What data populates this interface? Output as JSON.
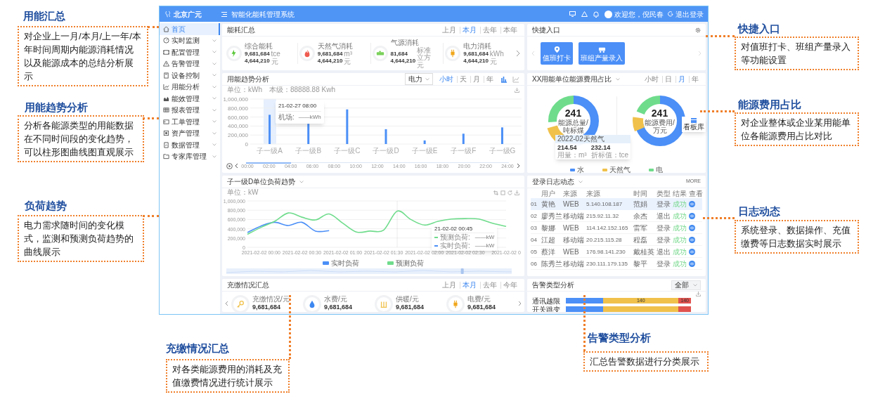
{
  "annotations": [
    {
      "title": "用能汇总",
      "text": "对企业上一月/本月/上一年/本年时间周期内能源消耗情况以及能源成本的总结分析展示"
    },
    {
      "title": "用能趋势分析",
      "text": "分析各能源类型的用能数据在不同时间段的变化趋势，可以柱形图曲线图直观展示"
    },
    {
      "title": "负荷趋势",
      "text": "电力需求随时间的变化模式，监测和预测负荷趋势的曲线展示"
    },
    {
      "title": "充缴情况汇总",
      "text": "对各类能源费用的消耗及充值缴费情况进行统计展示"
    },
    {
      "title": "快捷入口",
      "text": "对值班打卡、班组产量录入等功能设置"
    },
    {
      "title": "能源费用占比",
      "text": "对企业整体或企业某用能单位各能源费用占比对比"
    },
    {
      "title": "日志动态",
      "text": "系统登录、数据操作、充值缴费等日志数据实时展示"
    },
    {
      "title": "告警类型分析",
      "text": "汇总告警数据进行分类展示"
    }
  ],
  "header": {
    "logo": "北京广元",
    "title": "智能化能耗管理系统",
    "user": "欢迎您，倪民春",
    "logout": "退出登录"
  },
  "sidebar": {
    "items": [
      {
        "label": "首页",
        "selected": true,
        "expandable": false
      },
      {
        "label": "实时监测",
        "selected": false,
        "expandable": true
      },
      {
        "label": "配置管理",
        "selected": false,
        "expandable": true
      },
      {
        "label": "告警管理",
        "selected": false,
        "expandable": true
      },
      {
        "label": "设备控制",
        "selected": false,
        "expandable": true
      },
      {
        "label": "用能分析",
        "selected": false,
        "expandable": true
      },
      {
        "label": "能效管理",
        "selected": false,
        "expandable": true
      },
      {
        "label": "报表管理",
        "selected": false,
        "expandable": true
      },
      {
        "label": "工单管理",
        "selected": false,
        "expandable": true
      },
      {
        "label": "资产管理",
        "selected": false,
        "expandable": true
      },
      {
        "label": "数据管理",
        "selected": false,
        "expandable": true
      },
      {
        "label": "专家库管理",
        "selected": false,
        "expandable": true
      }
    ]
  },
  "energy_summary": {
    "title": "能耗汇总",
    "periods": [
      {
        "label": "上月",
        "selected": false
      },
      {
        "label": "本月",
        "selected": true
      },
      {
        "label": "去年",
        "selected": false
      },
      {
        "label": "本年",
        "selected": false
      }
    ],
    "items": [
      {
        "kind": "bolt",
        "label": "综合能耗",
        "value": "9,681,684",
        "unit": "tce",
        "cost": "4,644,210",
        "cost_unit": "元"
      },
      {
        "kind": "flame",
        "label": "天然气消耗",
        "value": "9,681,684",
        "unit": "m³",
        "cost": "4,644,210",
        "cost_unit": "元"
      },
      {
        "kind": "gas",
        "label": "气源消耗",
        "value": "81,684",
        "unit": "标准立方",
        "cost": "4,644,210",
        "cost_unit": "元"
      },
      {
        "kind": "plug",
        "label": "电力消耗",
        "value": "9,681,684",
        "unit": "kWh",
        "cost": "4,644,210",
        "cost_unit": "元"
      }
    ]
  },
  "quick_entry": {
    "title": "快捷入口",
    "items": [
      {
        "kind": "location",
        "label": "值班打卡"
      },
      {
        "kind": "truck",
        "label": "班组产量录入"
      }
    ]
  },
  "trend": {
    "title": "用能趋势分析",
    "energy_select": "电力",
    "periods": [
      {
        "label": "小时",
        "selected": true
      },
      {
        "label": "天",
        "selected": false
      },
      {
        "label": "月",
        "selected": false
      },
      {
        "label": "年",
        "selected": false
      }
    ],
    "chart_types": [
      {
        "kind": "bar",
        "selected": true
      },
      {
        "kind": "line",
        "selected": false
      }
    ],
    "unit": "单位：kWh",
    "total": "本级：88888.88 Kwh",
    "tooltip": {
      "time": "21-02-27 08:00",
      "label": "机场:",
      "value": "——kWh"
    },
    "chart_data": {
      "type": "bar",
      "grid": true,
      "categories": [
        "子一级A",
        "子一级B",
        "子一级C",
        "子一级D",
        "子一级E",
        "子一级F",
        "子一级G"
      ],
      "values": [
        650000,
        450000,
        770000,
        330000,
        80000,
        230000,
        370000
      ],
      "ylim": [
        0,
        1000000
      ],
      "yticks": [
        {
          "value": 0,
          "label": "0"
        },
        {
          "value": 200000,
          "label": "200,000"
        },
        {
          "value": 400000,
          "label": "400,000"
        },
        {
          "value": 600000,
          "label": "600,000"
        },
        {
          "value": 800000,
          "label": "800,000"
        },
        {
          "value": 1000000,
          "label": "1,000,000"
        }
      ]
    },
    "timeline": {
      "labels": [
        "00:00",
        "02:00",
        "04:00",
        "06:00",
        "08:00",
        "10:00",
        "12:00",
        "14:00",
        "16:00",
        "18:00",
        "20:00",
        "22:00",
        "24:00"
      ],
      "level": 0.17
    }
  },
  "share": {
    "title": "XX用能单位能源费用占比",
    "periods": [
      {
        "label": "小时",
        "selected": false
      },
      {
        "label": "日",
        "selected": false
      },
      {
        "label": "月",
        "selected": true
      },
      {
        "label": "年",
        "selected": false
      }
    ],
    "donuts": [
      {
        "value": "241",
        "label": "能源总量/吨标煤"
      },
      {
        "value": "241",
        "label": "能源费用/万元"
      }
    ],
    "legend": [
      {
        "label": "水",
        "color": "#4b8ff7"
      },
      {
        "label": "天然气",
        "color": "#f0c14b"
      },
      {
        "label": "电",
        "color": "#6fdc8c"
      }
    ],
    "tooltip": {
      "title": "2022-02天然气",
      "items": [
        {
          "value": "214.54",
          "label": "用量：m³"
        },
        {
          "value": "232.14",
          "label": "折标值：tce"
        }
      ]
    },
    "board_button": "看板库"
  },
  "load": {
    "title": "子一级D单位负荷趋势",
    "unit": "单位：kW",
    "zoom_slider": {
      "level": 0.83
    },
    "chart_data": {
      "type": "line",
      "grid": true,
      "categories": [
        null,
        "2021-02-02 00:00",
        null,
        null,
        "2021-02-02 00:30",
        null,
        null,
        "2021-02-02 01:00",
        null,
        null,
        "2021-02-02 01:30",
        null,
        null,
        "2021-02-02 02:00",
        null,
        null,
        "2021-02-02 02:30",
        null,
        null,
        "2021-02-02 0"
      ],
      "ylim": [
        0,
        1000000
      ],
      "yticks": [
        {
          "value": 0,
          "label": "0"
        },
        {
          "value": 200000,
          "label": "200,000"
        },
        {
          "value": 400000,
          "label": "400,000"
        },
        {
          "value": 600000,
          "label": "600,000"
        },
        {
          "value": 800000,
          "label": "800,000"
        },
        {
          "value": 1000000,
          "label": "1,000,000"
        }
      ],
      "series": [
        {
          "name": "实时负荷",
          "color": "#4b8ff7",
          "values": [
            320000,
            460000,
            540000,
            470000,
            540000,
            350000,
            360000,
            null,
            null,
            null,
            null,
            null,
            null,
            null,
            null,
            null,
            null,
            null,
            null,
            null
          ]
        },
        {
          "name": "预测负荷",
          "color": "#6fdc8c",
          "values": [
            280000,
            430000,
            560000,
            740000,
            650000,
            590000,
            720000,
            520000,
            330000,
            350000,
            370000,
            780000,
            600000,
            480000,
            560000,
            610000,
            620000,
            610000,
            520000,
            450000
          ]
        }
      ]
    },
    "tooltip": {
      "time": "21-02-02 00:45",
      "rows": [
        {
          "label": "预测负荷:",
          "value": "——kW",
          "color": "#6fdc8c"
        },
        {
          "label": "实时负荷:",
          "value": "——kW",
          "color": "#4b8ff7"
        }
      ]
    }
  },
  "log": {
    "title": "登录日志动态",
    "more": "MORE",
    "columns": [
      "用户",
      "来源",
      "来源",
      "时间",
      "类型",
      "结果",
      "查看"
    ],
    "rows": [
      {
        "no": "01",
        "user": "黄艳",
        "client": "WEB",
        "ip": "5.140.108.187",
        "name": "范娟",
        "action": "登录",
        "result": "成功",
        "selected": true
      },
      {
        "no": "02",
        "user": "廖秀兰",
        "client": "移动端",
        "ip": "215.92.11.32",
        "name": "余杰",
        "action": "退出",
        "result": "成功",
        "selected": false
      },
      {
        "no": "03",
        "user": "黎娜",
        "client": "WEB",
        "ip": "114.142.152.165",
        "name": "雷军",
        "action": "登录",
        "result": "成功",
        "selected": false
      },
      {
        "no": "04",
        "user": "江超",
        "client": "移动端",
        "ip": "20.215.115.28",
        "name": "程磊",
        "action": "登录",
        "result": "成功",
        "selected": false
      },
      {
        "no": "05",
        "user": "蔡洋",
        "client": "WEB",
        "ip": "176.98.141.230",
        "name": "戴桂英",
        "action": "退出",
        "result": "成功",
        "selected": false
      },
      {
        "no": "06",
        "user": "陈秀兰",
        "client": "移动端",
        "ip": "230.111.179.135",
        "name": "黎平",
        "action": "登录",
        "result": "成功",
        "selected": false
      }
    ]
  },
  "payment": {
    "title": "充缴情况汇总",
    "periods": [
      {
        "label": "上月",
        "selected": false
      },
      {
        "label": "本月",
        "selected": true
      },
      {
        "label": "去年",
        "selected": false
      },
      {
        "label": "今年",
        "selected": false
      }
    ],
    "items": [
      {
        "kind": "key",
        "label": "充缴情况/元",
        "value": "9,681,684"
      },
      {
        "kind": "water",
        "label": "水费/元",
        "value": "9,681,684"
      },
      {
        "kind": "heat",
        "label": "供暖/元",
        "value": "9,681,684"
      },
      {
        "kind": "plug",
        "label": "电费/元",
        "value": "9,681,684"
      }
    ]
  },
  "alarm": {
    "title": "告警类型分析",
    "filter": "全部",
    "rows": [
      {
        "label": "通讯越限",
        "value_labels": [
          "140",
          "140"
        ]
      },
      {
        "label": "开关跳变"
      }
    ]
  }
}
